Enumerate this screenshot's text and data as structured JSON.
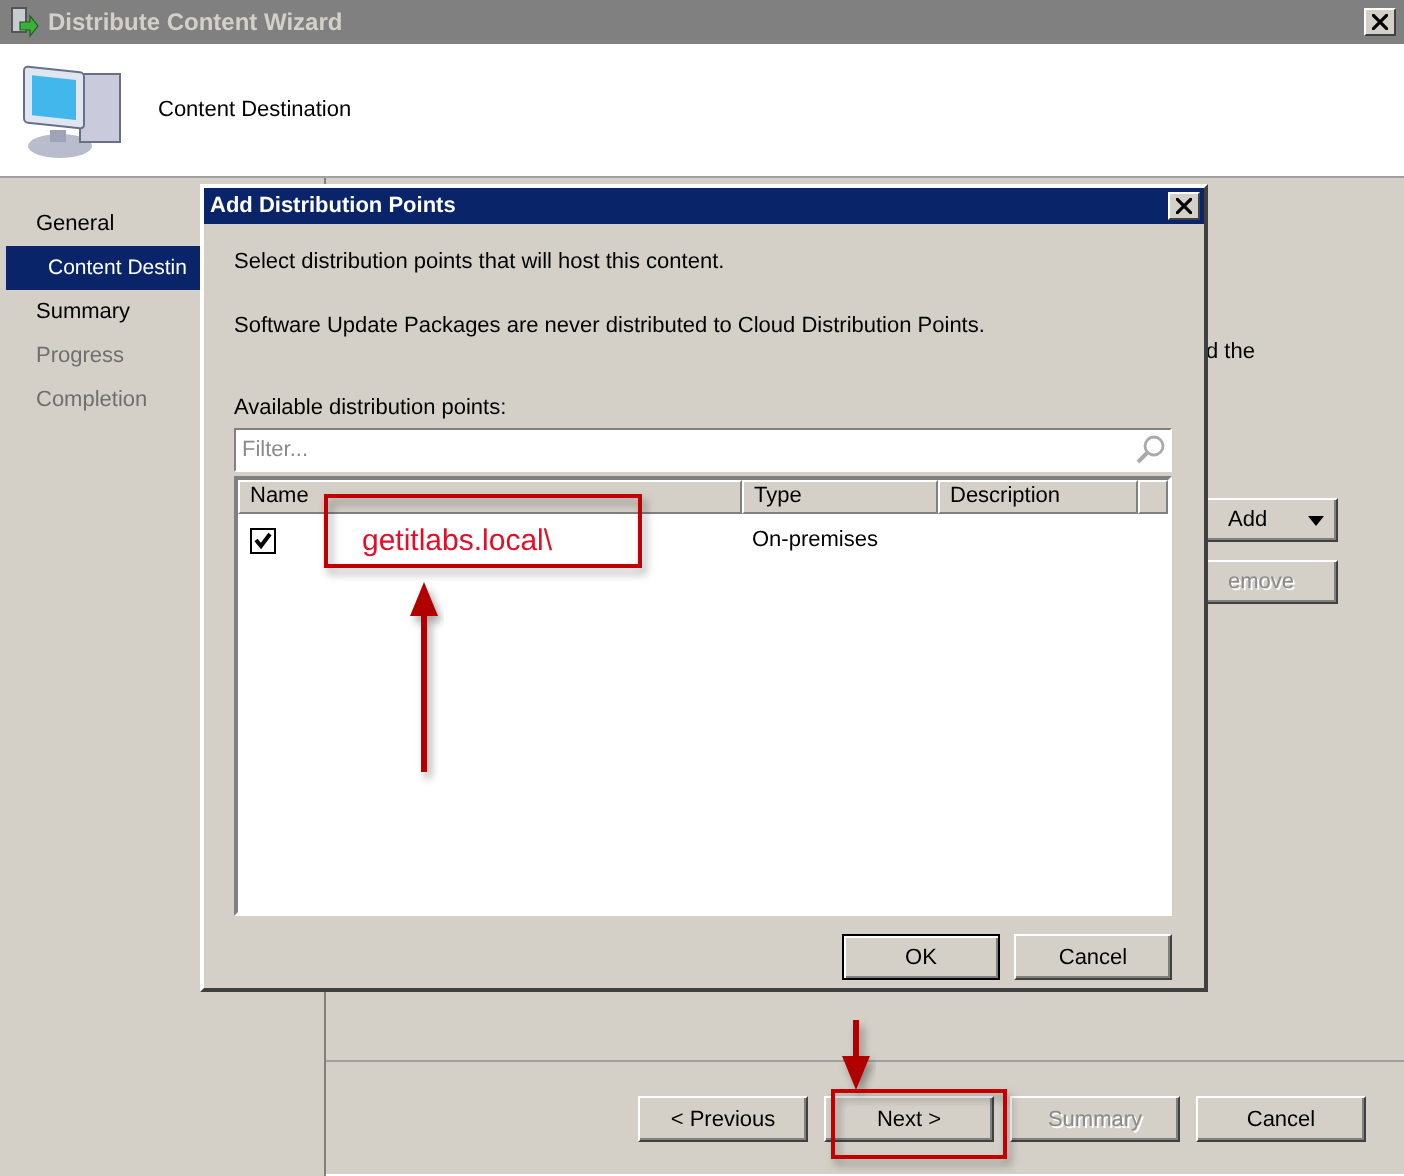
{
  "window": {
    "title": "Distribute Content Wizard"
  },
  "header": {
    "title": "Content Destination"
  },
  "steps": [
    {
      "label": "General",
      "selected": false,
      "disabled": false,
      "children": [
        {
          "label": "Content Destin",
          "selected": true,
          "disabled": false
        }
      ]
    },
    {
      "label": "Summary",
      "selected": false,
      "disabled": false
    },
    {
      "label": "Progress",
      "selected": false,
      "disabled": true
    },
    {
      "label": "Completion",
      "selected": false,
      "disabled": true
    }
  ],
  "page": {
    "text_fragment": "d the",
    "buttons": [
      {
        "label": "Add",
        "kind": "dropdown",
        "disabled": false
      },
      {
        "label": "emove",
        "kind": "plain",
        "disabled": true
      }
    ]
  },
  "dialog": {
    "title": "Add Distribution Points",
    "intro": "Select distribution points that will host this content.",
    "note": "Software Update Packages are never distributed to Cloud Distribution Points.",
    "list_label": "Available distribution points:",
    "filter": {
      "placeholder": "Filter..."
    },
    "columns": [
      "Name",
      "Type",
      "Description"
    ],
    "rows": [
      {
        "checked": true,
        "name": "getitlabs.local\\",
        "type": "On-premises"
      }
    ],
    "buttons": [
      {
        "label": "OK",
        "default": true
      },
      {
        "label": "Cancel",
        "default": false
      }
    ]
  },
  "nav_buttons": [
    {
      "label": "< Previous",
      "disabled": false
    },
    {
      "label": "Next >",
      "disabled": false
    },
    {
      "label": "Summary",
      "disabled": true
    },
    {
      "label": "Cancel",
      "disabled": false
    }
  ]
}
